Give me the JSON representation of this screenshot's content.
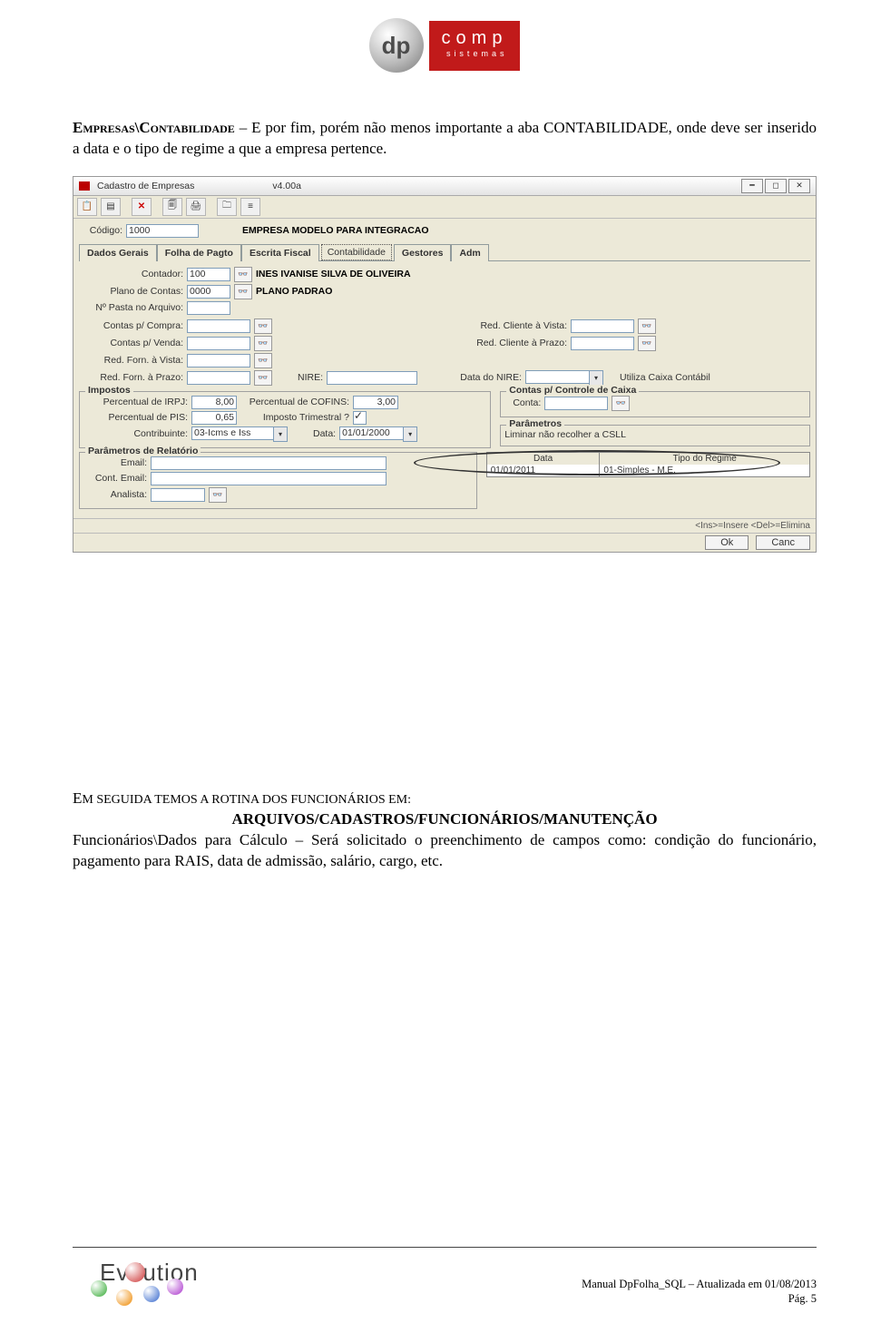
{
  "header_logo": {
    "sphere_text": "dp",
    "line1": "comp",
    "line2": "sistemas"
  },
  "para1": {
    "lead_smallcaps": "Empresas\\Contabilidade",
    "rest": " – E por fim, porém não menos importante a aba CONTABILIDADE, onde deve ser inserido a data e o tipo de regime a que a empresa pertence."
  },
  "window": {
    "title": "Cadastro de Empresas",
    "version": "v4.00a",
    "codigo_label": "Código:",
    "codigo_value": "1000",
    "empresa_nome": "EMPRESA MODELO PARA INTEGRACAO",
    "tabs": [
      "Dados Gerais",
      "Folha de Pagto",
      "Escrita Fiscal",
      "Contabilidade",
      "Gestores",
      "Adm"
    ],
    "active_tab_index": 3,
    "contador_label": "Contador:",
    "contador_value": "100",
    "contador_nome": "INES IVANISE SILVA DE OLIVEIRA",
    "plano_label": "Plano de Contas:",
    "plano_value": "0000",
    "plano_nome": "PLANO PADRAO",
    "pasta_label": "Nº Pasta no Arquivo:",
    "contas_compra_label": "Contas p/ Compra:",
    "contas_venda_label": "Contas p/ Venda:",
    "red_forn_vista_label": "Red. Forn. à Vista:",
    "red_forn_prazo_label": "Red. Forn. à Prazo:",
    "red_cli_vista_label": "Red. Cliente à Vista:",
    "red_cli_prazo_label": "Red. Cliente à Prazo:",
    "nire_label": "NIRE:",
    "data_nire_label": "Data do NIRE:",
    "utiliza_caixa_label": "Utiliza Caixa Contábil",
    "impostos_legend": "Impostos",
    "perc_irpj_label": "Percentual de IRPJ:",
    "perc_irpj_value": "8,00",
    "perc_cofins_label": "Percentual de COFINS:",
    "perc_cofins_value": "3,00",
    "perc_pis_label": "Percentual de PIS:",
    "perc_pis_value": "0,65",
    "imposto_trim_label": "Imposto Trimestral ?",
    "contribuinte_label": "Contribuinte:",
    "contribuinte_value": "03-Icms e Iss",
    "data_label": "Data:",
    "data_value": "01/01/2000",
    "contas_caixa_legend": "Contas p/ Controle de Caixa",
    "conta_label": "Conta:",
    "parametros_legend": "Parâmetros",
    "liminar_label": "Liminar não recolher a CSLL",
    "param_rel_legend": "Parâmetros de Relatório",
    "email_label": "Email:",
    "cont_email_label": "Cont. Email:",
    "analista_label": "Analista:",
    "regime_grid": {
      "col1": "Data",
      "col2": "Tipo do Regime",
      "row_date": "01/01/2011",
      "row_tipo": "01-Simples - M.E."
    },
    "status_hint": "<Ins>=Insere <Del>=Elimina",
    "ok_btn": "Ok",
    "cancel_btn": "Canc"
  },
  "para2": {
    "lead": "EM SEGUIDA TEMOS A ROTINA DOS FUNCIONÁRIOS EM:",
    "path": "ARQUIVOS/CADASTROS/FUNCIONÁRIOS/MANUTENÇÃO",
    "sc": "Funcionários\\Dados para Cálculo",
    "rest": " – Será solicitado o preenchimento de campos como: condição do funcionário, pagamento para RAIS, data de admissão, salário, cargo, etc."
  },
  "footer": {
    "logo_text": "Ev   lution",
    "right1": "Manual DpFolha_SQL – Atualizada em 01/08/2013",
    "right2": "Pág. 5"
  }
}
